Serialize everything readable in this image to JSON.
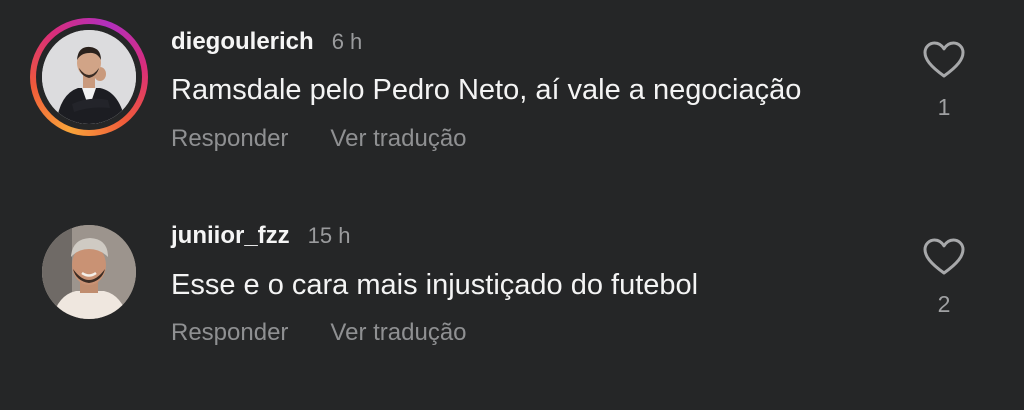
{
  "comments": [
    {
      "username": "diegoulerich",
      "time": "6 h",
      "text": "Ramsdale pelo Pedro Neto, aí vale a negociação",
      "reply_label": "Responder",
      "translate_label": "Ver tradução",
      "like_count": "1",
      "has_story_ring": true,
      "avatar_icon": "man-in-suit-avatar"
    },
    {
      "username": "juniior_fzz",
      "time": "15 h",
      "text": "Esse e o cara mais injustiçado do futebol",
      "reply_label": "Responder",
      "translate_label": "Ver tradução",
      "like_count": "2",
      "has_story_ring": false,
      "avatar_icon": "smiling-man-avatar"
    }
  ],
  "colors": {
    "background": "#252627",
    "primary_text": "#f4f4f4",
    "secondary_text": "#8f9092",
    "ring_start": "#f9a43a",
    "ring_end": "#b12fbf"
  }
}
